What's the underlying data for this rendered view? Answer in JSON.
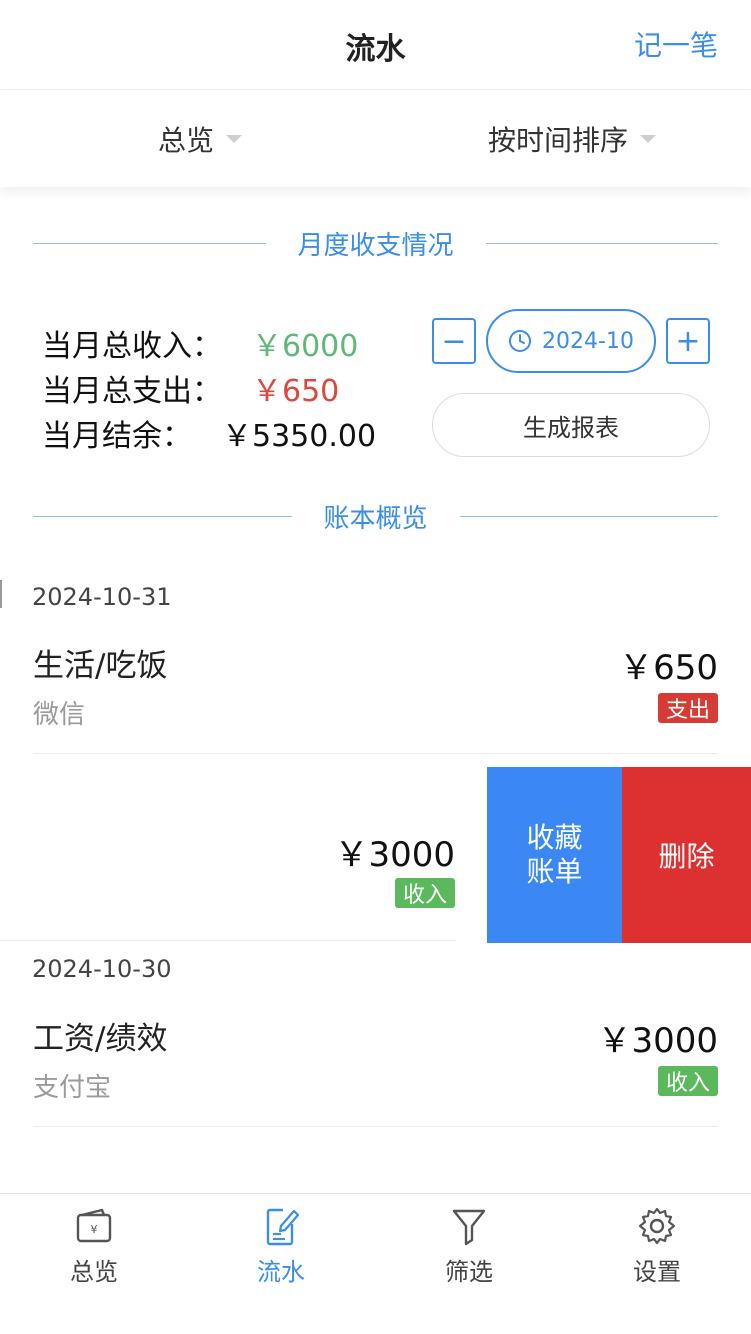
{
  "header": {
    "title": "流水",
    "action": "记一笔"
  },
  "filters": {
    "overview": "总览",
    "sort": "按时间排序"
  },
  "month_section": {
    "heading": "月度收支情况",
    "income_label": "当月总收入：",
    "income_value": "￥6000",
    "expense_label": "当月总支出：",
    "expense_value": "￥650",
    "balance_label": "当月结余：",
    "balance_value": "￥5350.00",
    "minus": "−",
    "plus": "+",
    "month": "2024-10",
    "report_button": "生成报表"
  },
  "ledger_section": {
    "heading": "账本概览"
  },
  "groups": [
    {
      "date": "2024-10-31",
      "items": [
        {
          "category": "生活/吃饭",
          "account": "微信",
          "amount": "￥650",
          "type": "支出"
        }
      ]
    }
  ],
  "swiped_item": {
    "amount": "￥3000",
    "type": "收入",
    "fav_action": "收藏\n账单",
    "delete_action": "删除"
  },
  "group2": {
    "date": "2024-10-30",
    "item": {
      "category": "工资/绩效",
      "account": "支付宝",
      "amount": "￥3000",
      "type": "收入"
    }
  },
  "tabbar": {
    "items": [
      {
        "label": "总览",
        "icon": "wallet-icon"
      },
      {
        "label": "流水",
        "icon": "note-edit-icon"
      },
      {
        "label": "筛选",
        "icon": "filter-icon"
      },
      {
        "label": "设置",
        "icon": "gear-icon"
      }
    ],
    "active": "流水"
  },
  "colors": {
    "accent": "#3a8ee6",
    "income": "#5fb878",
    "expense": "#e0463c",
    "fav": "#3b88f5",
    "delete": "#dd3030"
  }
}
